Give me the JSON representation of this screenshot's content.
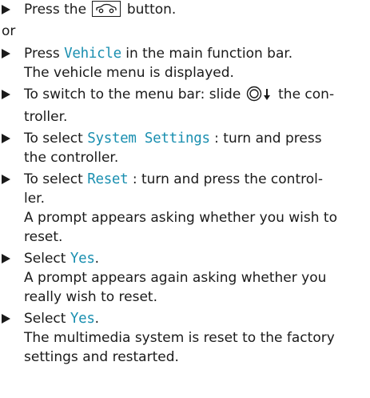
{
  "steps": [
    {
      "pre": "Press the",
      "post": "button.",
      "icon": "car-icon"
    },
    {
      "separator": "or"
    },
    {
      "pre": "Press",
      "kw": "Vehicle",
      "post": "in the main function bar.",
      "result": "The vehicle menu is displayed."
    },
    {
      "pre": "To switch to the menu bar: slide",
      "post": "the con-",
      "post2": "troller.",
      "icon": "controller-slide-down-icon"
    },
    {
      "pre": "To select",
      "kw": "System Settings",
      "post": ": turn and press",
      "post2": "the controller."
    },
    {
      "pre": "To select",
      "kw": "Reset",
      "post": ": turn and press the control-",
      "post2": "ler.",
      "result1": "A prompt appears asking whether you wish to",
      "result2": "reset."
    },
    {
      "pre": "Select",
      "kw": "Yes",
      "post": ".",
      "result1": "A prompt appears again asking whether you",
      "result2": "really wish to reset."
    },
    {
      "pre": "Select",
      "kw": "Yes",
      "post": ".",
      "result1": "The multimedia system is reset to the factory",
      "result2": "settings and restarted."
    }
  ]
}
